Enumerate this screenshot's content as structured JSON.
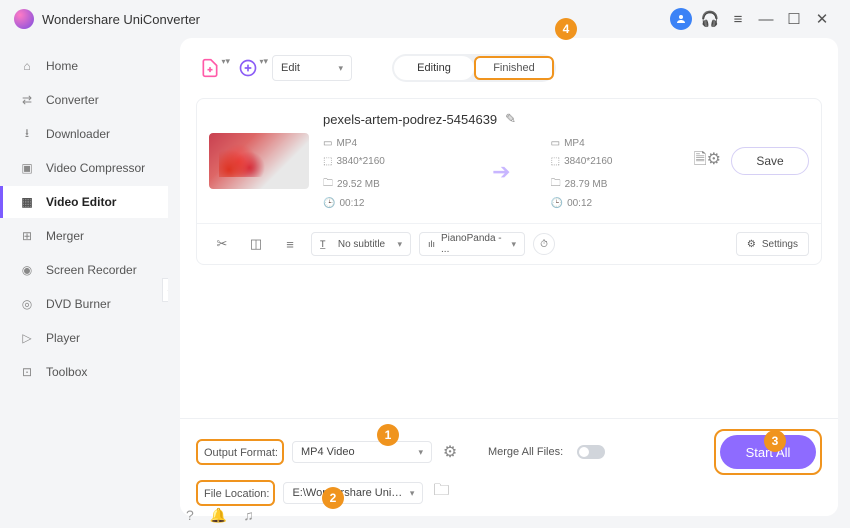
{
  "app": {
    "title": "Wondershare UniConverter"
  },
  "sidebar": {
    "items": [
      {
        "label": "Home"
      },
      {
        "label": "Converter"
      },
      {
        "label": "Downloader"
      },
      {
        "label": "Video Compressor"
      },
      {
        "label": "Video Editor"
      },
      {
        "label": "Merger"
      },
      {
        "label": "Screen Recorder"
      },
      {
        "label": "DVD Burner"
      },
      {
        "label": "Player"
      },
      {
        "label": "Toolbox"
      }
    ]
  },
  "toolbar": {
    "edit_label": "Edit",
    "tabs": {
      "editing": "Editing",
      "finished": "Finished"
    }
  },
  "file": {
    "name": "pexels-artem-podrez-5454639",
    "src": {
      "format": "MP4",
      "resolution": "3840*2160",
      "size": "29.52 MB",
      "duration": "00:12"
    },
    "dst": {
      "format": "MP4",
      "resolution": "3840*2160",
      "size": "28.79 MB",
      "duration": "00:12"
    },
    "save_label": "Save",
    "subtitle": "No subtitle",
    "audio": "PianoPanda - ...",
    "settings_label": "Settings"
  },
  "bottom": {
    "output_format_label": "Output Format:",
    "output_format_value": "MP4 Video",
    "file_location_label": "File Location:",
    "file_location_value": "E:\\Wondershare UniConverter",
    "merge_label": "Merge All Files:",
    "start_all": "Start All"
  },
  "badges": {
    "b1": "1",
    "b2": "2",
    "b3": "3",
    "b4": "4"
  }
}
